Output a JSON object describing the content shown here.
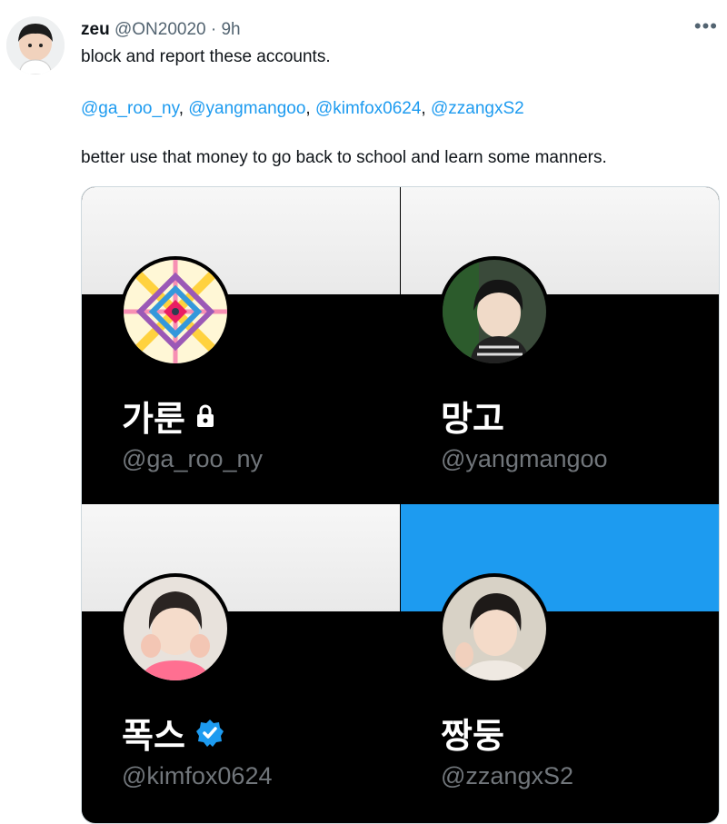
{
  "tweet": {
    "author_name": "zeu",
    "author_handle": "@ON20020",
    "separator": "·",
    "time": "9h",
    "more_label": "•••",
    "line1": "block and report these accounts.",
    "mentions": [
      "@ga_roo_ny",
      "@yangmangoo",
      "@kimfox0624",
      "@zzangxS2"
    ],
    "mention_sep": ", ",
    "line3": "better use that money to go back to school and learn some manners."
  },
  "cards": [
    {
      "display_name": "가룬",
      "username": "@ga_roo_ny",
      "banner": "white",
      "badge": "lock-icon"
    },
    {
      "display_name": "망고",
      "username": "@yangmangoo",
      "banner": "white",
      "badge": ""
    },
    {
      "display_name": "폭스",
      "username": "@kimfox0624",
      "banner": "white",
      "badge": "verified-icon"
    },
    {
      "display_name": "짱둥",
      "username": "@zzangxS2",
      "banner": "blue",
      "badge": ""
    }
  ],
  "colors": {
    "accent": "#1d9bf0",
    "text": "#0f1419",
    "muted": "#536471",
    "card_bg": "#000000",
    "card_username": "#71767b"
  }
}
